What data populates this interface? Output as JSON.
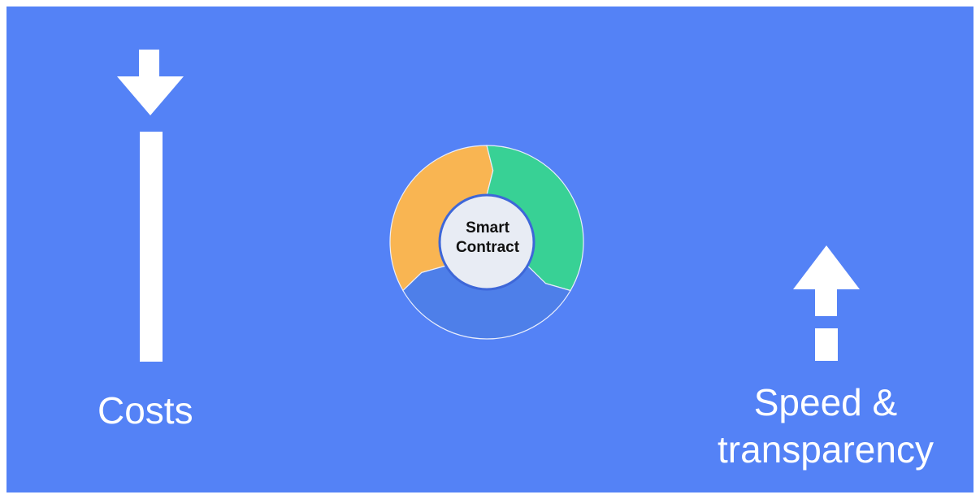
{
  "slide": {
    "background_color": "#5482f6",
    "frame_color": "#ffffff"
  },
  "left_indicator": {
    "direction": "down",
    "icon": "arrow-down-icon",
    "label": "Costs",
    "color": "#ffffff"
  },
  "right_indicator": {
    "direction": "up",
    "icon": "arrow-up-icon",
    "label_line1": "Speed &",
    "label_line2": "transparency",
    "color": "#ffffff"
  },
  "cycle": {
    "center_line1": "Smart",
    "center_line2": "Contract",
    "center_fill": "#e8ecf4",
    "segments": [
      {
        "name": "orange",
        "color": "#f9b552"
      },
      {
        "name": "green",
        "color": "#38d195"
      },
      {
        "name": "blue",
        "color": "#4e7fe9"
      }
    ]
  }
}
